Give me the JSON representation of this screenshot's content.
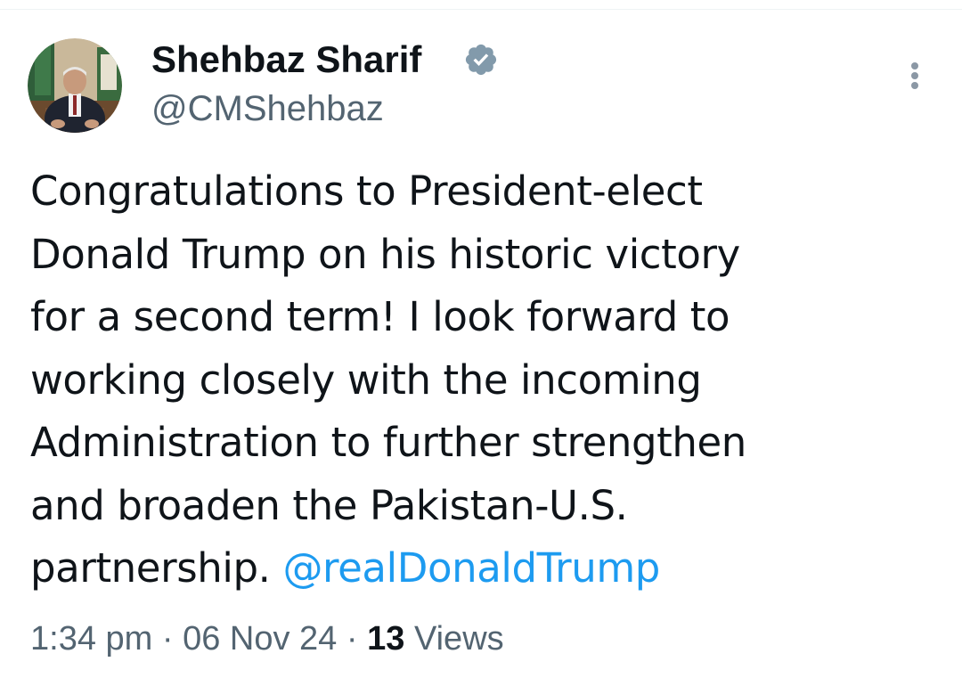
{
  "author": {
    "display_name": "Shehbaz Sharif",
    "handle": "@CMShehbaz",
    "verified": true,
    "verified_badge_color": "#829aab"
  },
  "tweet": {
    "lines": [
      "Congratulations to President-elect",
      "Donald Trump on his historic victory",
      "for a second term! I look forward to",
      "working closely with the incoming",
      "Administration to further strengthen",
      "and broaden the Pakistan-U.S."
    ],
    "last_line_prefix": "partnership. ",
    "mention": "@realDonaldTrump"
  },
  "meta": {
    "time": "1:34 pm",
    "separator": "·",
    "date": "06 Nov 24",
    "views_count": "13",
    "views_label": "Views"
  },
  "colors": {
    "text_primary": "#0f1419",
    "text_secondary": "#536471",
    "link": "#1d9bf0"
  },
  "icons": {
    "more": "more-vertical-icon",
    "verified": "verified-badge-icon"
  }
}
